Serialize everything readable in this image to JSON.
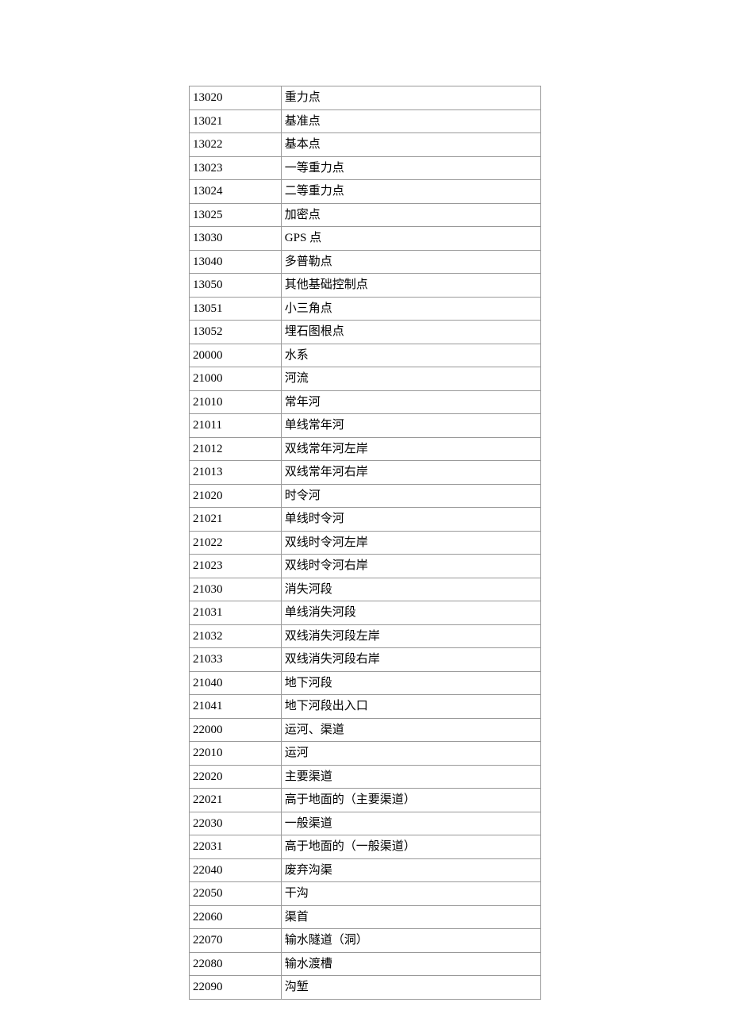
{
  "rows": [
    {
      "code": "13020",
      "name": "重力点"
    },
    {
      "code": "13021",
      "name": "基准点"
    },
    {
      "code": "13022",
      "name": "基本点"
    },
    {
      "code": "13023",
      "name": "一等重力点"
    },
    {
      "code": "13024",
      "name": "二等重力点"
    },
    {
      "code": "13025",
      "name": "加密点"
    },
    {
      "code": "13030",
      "name": "GPS 点"
    },
    {
      "code": "13040",
      "name": "多普勒点"
    },
    {
      "code": "13050",
      "name": "其他基础控制点"
    },
    {
      "code": "13051",
      "name": "小三角点"
    },
    {
      "code": "13052",
      "name": "埋石图根点"
    },
    {
      "code": "20000",
      "name": "水系"
    },
    {
      "code": "21000",
      "name": "河流"
    },
    {
      "code": "21010",
      "name": "常年河"
    },
    {
      "code": "21011",
      "name": "单线常年河"
    },
    {
      "code": "21012",
      "name": "双线常年河左岸"
    },
    {
      "code": "21013",
      "name": "双线常年河右岸"
    },
    {
      "code": "21020",
      "name": "时令河"
    },
    {
      "code": "21021",
      "name": "单线时令河"
    },
    {
      "code": "21022",
      "name": "双线时令河左岸"
    },
    {
      "code": "21023",
      "name": "双线时令河右岸"
    },
    {
      "code": "21030",
      "name": "消失河段"
    },
    {
      "code": "21031",
      "name": "单线消失河段"
    },
    {
      "code": "21032",
      "name": "双线消失河段左岸"
    },
    {
      "code": "21033",
      "name": "双线消失河段右岸"
    },
    {
      "code": "21040",
      "name": "地下河段"
    },
    {
      "code": "21041",
      "name": "地下河段出入口"
    },
    {
      "code": "22000",
      "name": "运河、渠道"
    },
    {
      "code": "22010",
      "name": "运河"
    },
    {
      "code": "22020",
      "name": "主要渠道"
    },
    {
      "code": "22021",
      "name": "高于地面的（主要渠道）"
    },
    {
      "code": "22030",
      "name": "一般渠道"
    },
    {
      "code": "22031",
      "name": "高于地面的（一般渠道）"
    },
    {
      "code": "22040",
      "name": "废弃沟渠"
    },
    {
      "code": "22050",
      "name": "干沟"
    },
    {
      "code": "22060",
      "name": "渠首"
    },
    {
      "code": "22070",
      "name": "输水隧道（洞）"
    },
    {
      "code": "22080",
      "name": "输水渡槽"
    },
    {
      "code": "22090",
      "name": "沟堑"
    }
  ]
}
